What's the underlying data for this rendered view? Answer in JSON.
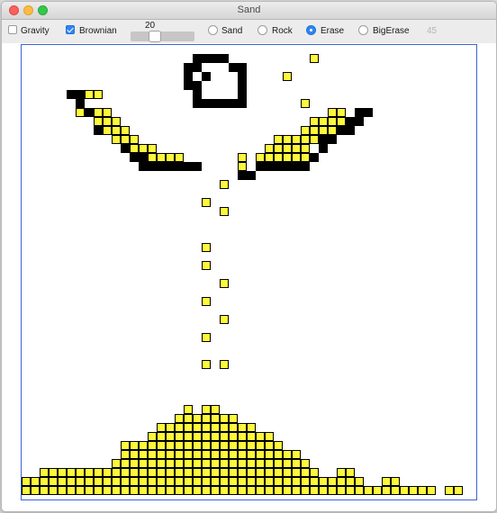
{
  "window": {
    "title": "Sand"
  },
  "toolbar": {
    "gravity": {
      "label": "Gravity",
      "checked": false
    },
    "brownian": {
      "label": "Brownian",
      "checked": true
    },
    "slider": {
      "value": "20",
      "level": 0.35
    },
    "modes": [
      {
        "label": "Sand",
        "selected": false
      },
      {
        "label": "Rock",
        "selected": false
      },
      {
        "label": "Erase",
        "selected": true
      },
      {
        "label": "BigErase",
        "selected": false
      }
    ],
    "counter": "45"
  },
  "colors": {
    "sand": "#fff83a",
    "rock": "#000000",
    "canvas_border": "#3b64d6",
    "accent": "#2d86f5"
  },
  "grid": {
    "size": 50,
    "rock": [
      [
        19,
        1
      ],
      [
        20,
        1
      ],
      [
        21,
        1
      ],
      [
        22,
        1
      ],
      [
        18,
        2
      ],
      [
        19,
        2
      ],
      [
        23,
        2
      ],
      [
        24,
        2
      ],
      [
        18,
        3
      ],
      [
        20,
        3
      ],
      [
        24,
        3
      ],
      [
        18,
        4
      ],
      [
        19,
        4
      ],
      [
        24,
        4
      ],
      [
        19,
        5
      ],
      [
        24,
        5
      ],
      [
        19,
        6
      ],
      [
        20,
        6
      ],
      [
        21,
        6
      ],
      [
        22,
        6
      ],
      [
        23,
        6
      ],
      [
        24,
        6
      ],
      [
        5,
        5
      ],
      [
        6,
        5
      ],
      [
        6,
        6
      ],
      [
        7,
        7
      ],
      [
        8,
        8
      ],
      [
        8,
        9
      ],
      [
        9,
        9
      ],
      [
        10,
        10
      ],
      [
        11,
        11
      ],
      [
        12,
        12
      ],
      [
        13,
        12
      ],
      [
        13,
        13
      ],
      [
        14,
        13
      ],
      [
        15,
        13
      ],
      [
        16,
        13
      ],
      [
        17,
        13
      ],
      [
        18,
        13
      ],
      [
        19,
        13
      ],
      [
        37,
        7
      ],
      [
        38,
        7
      ],
      [
        36,
        8
      ],
      [
        37,
        8
      ],
      [
        35,
        9
      ],
      [
        36,
        9
      ],
      [
        33,
        10
      ],
      [
        34,
        10
      ],
      [
        33,
        11
      ],
      [
        32,
        12
      ],
      [
        31,
        13
      ],
      [
        30,
        13
      ],
      [
        29,
        13
      ],
      [
        28,
        13
      ],
      [
        27,
        13
      ],
      [
        26,
        13
      ],
      [
        25,
        14
      ],
      [
        24,
        14
      ]
    ],
    "sand": [
      [
        32,
        1
      ],
      [
        29,
        3
      ],
      [
        31,
        6
      ],
      [
        7,
        5
      ],
      [
        8,
        5
      ],
      [
        6,
        7
      ],
      [
        8,
        7
      ],
      [
        9,
        7
      ],
      [
        8,
        8
      ],
      [
        9,
        8
      ],
      [
        10,
        8
      ],
      [
        9,
        9
      ],
      [
        10,
        9
      ],
      [
        11,
        9
      ],
      [
        10,
        10
      ],
      [
        11,
        10
      ],
      [
        12,
        10
      ],
      [
        12,
        11
      ],
      [
        13,
        11
      ],
      [
        14,
        11
      ],
      [
        14,
        12
      ],
      [
        15,
        12
      ],
      [
        16,
        12
      ],
      [
        17,
        12
      ],
      [
        34,
        7
      ],
      [
        35,
        7
      ],
      [
        32,
        8
      ],
      [
        33,
        8
      ],
      [
        34,
        8
      ],
      [
        35,
        8
      ],
      [
        31,
        9
      ],
      [
        32,
        9
      ],
      [
        33,
        9
      ],
      [
        34,
        9
      ],
      [
        29,
        10
      ],
      [
        30,
        10
      ],
      [
        31,
        10
      ],
      [
        32,
        10
      ],
      [
        28,
        10
      ],
      [
        27,
        11
      ],
      [
        28,
        11
      ],
      [
        29,
        11
      ],
      [
        30,
        11
      ],
      [
        31,
        11
      ],
      [
        26,
        12
      ],
      [
        27,
        12
      ],
      [
        28,
        12
      ],
      [
        29,
        12
      ],
      [
        30,
        12
      ],
      [
        31,
        12
      ],
      [
        24,
        12
      ],
      [
        24,
        13
      ],
      [
        22,
        15
      ],
      [
        20,
        17
      ],
      [
        22,
        18
      ],
      [
        20,
        22
      ],
      [
        20,
        24
      ],
      [
        22,
        26
      ],
      [
        20,
        28
      ],
      [
        22,
        30
      ],
      [
        20,
        32
      ],
      [
        20,
        35
      ],
      [
        22,
        35
      ],
      [
        18,
        40
      ],
      [
        20,
        40
      ],
      [
        21,
        40
      ],
      [
        17,
        41
      ],
      [
        18,
        41
      ],
      [
        19,
        41
      ],
      [
        20,
        41
      ],
      [
        21,
        41
      ],
      [
        22,
        41
      ],
      [
        23,
        41
      ],
      [
        15,
        42
      ],
      [
        16,
        42
      ],
      [
        17,
        42
      ],
      [
        18,
        42
      ],
      [
        19,
        42
      ],
      [
        20,
        42
      ],
      [
        21,
        42
      ],
      [
        22,
        42
      ],
      [
        23,
        42
      ],
      [
        24,
        42
      ],
      [
        25,
        42
      ],
      [
        14,
        43
      ],
      [
        15,
        43
      ],
      [
        16,
        43
      ],
      [
        17,
        43
      ],
      [
        18,
        43
      ],
      [
        19,
        43
      ],
      [
        20,
        43
      ],
      [
        21,
        43
      ],
      [
        22,
        43
      ],
      [
        23,
        43
      ],
      [
        24,
        43
      ],
      [
        25,
        43
      ],
      [
        26,
        43
      ],
      [
        27,
        43
      ],
      [
        11,
        44
      ],
      [
        12,
        44
      ],
      [
        13,
        44
      ],
      [
        14,
        44
      ],
      [
        15,
        44
      ],
      [
        16,
        44
      ],
      [
        17,
        44
      ],
      [
        18,
        44
      ],
      [
        19,
        44
      ],
      [
        20,
        44
      ],
      [
        21,
        44
      ],
      [
        22,
        44
      ],
      [
        23,
        44
      ],
      [
        24,
        44
      ],
      [
        25,
        44
      ],
      [
        26,
        44
      ],
      [
        27,
        44
      ],
      [
        28,
        44
      ],
      [
        11,
        45
      ],
      [
        12,
        45
      ],
      [
        13,
        45
      ],
      [
        14,
        45
      ],
      [
        15,
        45
      ],
      [
        16,
        45
      ],
      [
        17,
        45
      ],
      [
        18,
        45
      ],
      [
        19,
        45
      ],
      [
        20,
        45
      ],
      [
        21,
        45
      ],
      [
        22,
        45
      ],
      [
        23,
        45
      ],
      [
        24,
        45
      ],
      [
        25,
        45
      ],
      [
        26,
        45
      ],
      [
        27,
        45
      ],
      [
        28,
        45
      ],
      [
        29,
        45
      ],
      [
        30,
        45
      ],
      [
        10,
        46
      ],
      [
        11,
        46
      ],
      [
        12,
        46
      ],
      [
        13,
        46
      ],
      [
        14,
        46
      ],
      [
        15,
        46
      ],
      [
        16,
        46
      ],
      [
        17,
        46
      ],
      [
        18,
        46
      ],
      [
        19,
        46
      ],
      [
        20,
        46
      ],
      [
        21,
        46
      ],
      [
        22,
        46
      ],
      [
        23,
        46
      ],
      [
        24,
        46
      ],
      [
        25,
        46
      ],
      [
        26,
        46
      ],
      [
        27,
        46
      ],
      [
        28,
        46
      ],
      [
        29,
        46
      ],
      [
        30,
        46
      ],
      [
        31,
        46
      ],
      [
        8,
        47
      ],
      [
        9,
        47
      ],
      [
        10,
        47
      ],
      [
        11,
        47
      ],
      [
        12,
        47
      ],
      [
        13,
        47
      ],
      [
        14,
        47
      ],
      [
        15,
        47
      ],
      [
        16,
        47
      ],
      [
        17,
        47
      ],
      [
        18,
        47
      ],
      [
        19,
        47
      ],
      [
        20,
        47
      ],
      [
        21,
        47
      ],
      [
        22,
        47
      ],
      [
        23,
        47
      ],
      [
        24,
        47
      ],
      [
        25,
        47
      ],
      [
        26,
        47
      ],
      [
        27,
        47
      ],
      [
        28,
        47
      ],
      [
        29,
        47
      ],
      [
        30,
        47
      ],
      [
        31,
        47
      ],
      [
        32,
        47
      ],
      [
        2,
        47
      ],
      [
        3,
        47
      ],
      [
        4,
        47
      ],
      [
        5,
        47
      ],
      [
        6,
        47
      ],
      [
        7,
        47
      ],
      [
        35,
        47
      ],
      [
        36,
        47
      ],
      [
        0,
        48
      ],
      [
        1,
        48
      ],
      [
        2,
        48
      ],
      [
        3,
        48
      ],
      [
        4,
        48
      ],
      [
        5,
        48
      ],
      [
        6,
        48
      ],
      [
        7,
        48
      ],
      [
        8,
        48
      ],
      [
        9,
        48
      ],
      [
        10,
        48
      ],
      [
        11,
        48
      ],
      [
        12,
        48
      ],
      [
        13,
        48
      ],
      [
        14,
        48
      ],
      [
        15,
        48
      ],
      [
        16,
        48
      ],
      [
        17,
        48
      ],
      [
        18,
        48
      ],
      [
        19,
        48
      ],
      [
        20,
        48
      ],
      [
        21,
        48
      ],
      [
        22,
        48
      ],
      [
        23,
        48
      ],
      [
        24,
        48
      ],
      [
        25,
        48
      ],
      [
        26,
        48
      ],
      [
        27,
        48
      ],
      [
        28,
        48
      ],
      [
        29,
        48
      ],
      [
        30,
        48
      ],
      [
        31,
        48
      ],
      [
        32,
        48
      ],
      [
        33,
        48
      ],
      [
        34,
        48
      ],
      [
        35,
        48
      ],
      [
        36,
        48
      ],
      [
        37,
        48
      ],
      [
        40,
        48
      ],
      [
        41,
        48
      ],
      [
        0,
        49
      ],
      [
        1,
        49
      ],
      [
        2,
        49
      ],
      [
        3,
        49
      ],
      [
        4,
        49
      ],
      [
        5,
        49
      ],
      [
        6,
        49
      ],
      [
        7,
        49
      ],
      [
        8,
        49
      ],
      [
        9,
        49
      ],
      [
        10,
        49
      ],
      [
        11,
        49
      ],
      [
        12,
        49
      ],
      [
        13,
        49
      ],
      [
        14,
        49
      ],
      [
        15,
        49
      ],
      [
        16,
        49
      ],
      [
        17,
        49
      ],
      [
        18,
        49
      ],
      [
        19,
        49
      ],
      [
        20,
        49
      ],
      [
        21,
        49
      ],
      [
        22,
        49
      ],
      [
        23,
        49
      ],
      [
        24,
        49
      ],
      [
        25,
        49
      ],
      [
        26,
        49
      ],
      [
        27,
        49
      ],
      [
        28,
        49
      ],
      [
        29,
        49
      ],
      [
        30,
        49
      ],
      [
        31,
        49
      ],
      [
        32,
        49
      ],
      [
        33,
        49
      ],
      [
        34,
        49
      ],
      [
        35,
        49
      ],
      [
        36,
        49
      ],
      [
        37,
        49
      ],
      [
        38,
        49
      ],
      [
        39,
        49
      ],
      [
        40,
        49
      ],
      [
        41,
        49
      ],
      [
        42,
        49
      ],
      [
        43,
        49
      ],
      [
        44,
        49
      ],
      [
        45,
        49
      ],
      [
        47,
        49
      ],
      [
        48,
        49
      ]
    ]
  }
}
